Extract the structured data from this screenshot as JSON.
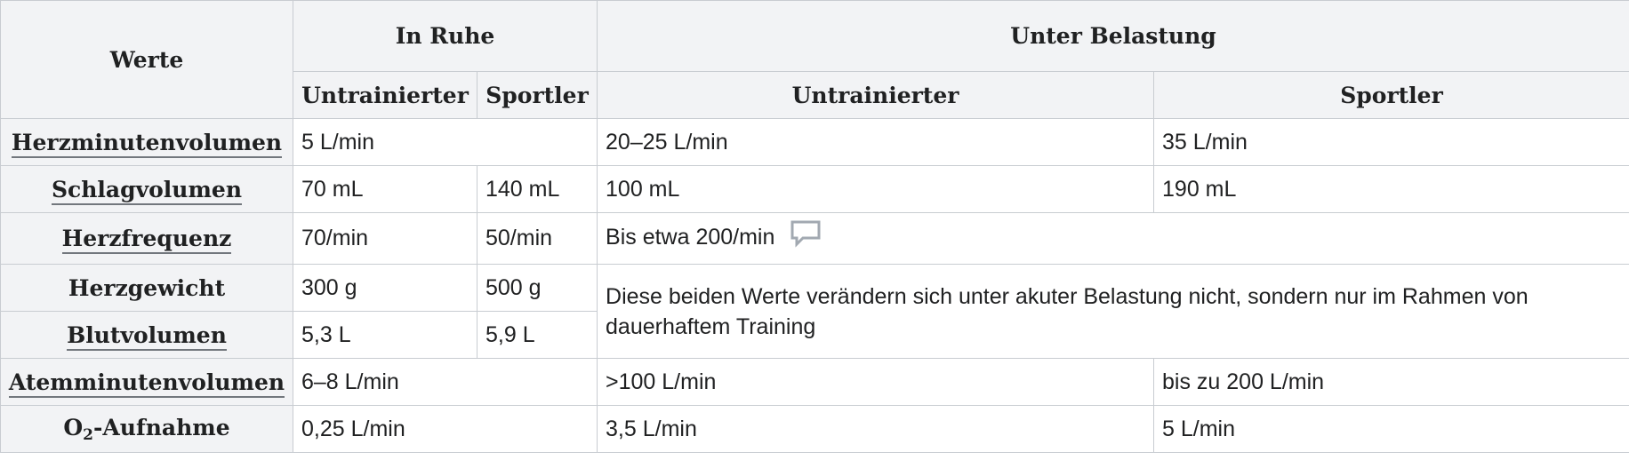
{
  "table": {
    "header": {
      "werte": "Werte",
      "in_ruhe": "In Ruhe",
      "unter_belastung": "Unter Belastung",
      "ruhe_untrainierter": "Untrainierter",
      "ruhe_sportler": "Sportler",
      "belastung_untrainierter": "Untrainierter",
      "belastung_sportler": "Sportler"
    },
    "rows": {
      "herzminutenvolumen": {
        "label": "Herzminutenvolumen",
        "ruhe": "5 L/min",
        "belastung_untrainierter": "20–25 L/min",
        "belastung_sportler": "35 L/min"
      },
      "schlagvolumen": {
        "label": "Schlagvolumen",
        "ruhe_untrainierter": "70 mL",
        "ruhe_sportler": "140 mL",
        "belastung_untrainierter": "100 mL",
        "belastung_sportler": "190 mL"
      },
      "herzfrequenz": {
        "label": "Herzfrequenz",
        "ruhe_untrainierter": "70/min",
        "ruhe_sportler": "50/min",
        "belastung": "Bis etwa 200/min",
        "comment_icon": "speech-bubble-icon"
      },
      "herzgewicht": {
        "label": "Herzgewicht",
        "ruhe_untrainierter": "300 g",
        "ruhe_sportler": "500 g"
      },
      "blutvolumen": {
        "label": "Blutvolumen",
        "ruhe_untrainierter": "5,3 L",
        "ruhe_sportler": "5,9 L"
      },
      "belastung_note": "Diese beiden Werte verändern sich unter akuter Belastung nicht, sondern nur im Rahmen von dauerhaftem Training",
      "atemminutenvolumen": {
        "label": "Atemminutenvolumen",
        "ruhe": "6–8 L/min",
        "belastung_untrainierter": ">100 L/min",
        "belastung_sportler": "bis zu 200 L/min"
      },
      "o2_aufnahme": {
        "label_prefix": "O",
        "label_sub": "2",
        "label_suffix": "-Aufnahme",
        "ruhe": "0,25 L/min",
        "belastung_untrainierter": "3,5 L/min",
        "belastung_sportler": "5 L/min"
      }
    }
  },
  "colors": {
    "header_bg": "#f2f3f5",
    "border": "#c8ccd1",
    "text": "#202122",
    "link_underline": "#72777d",
    "icon": "#a2a9b1"
  }
}
